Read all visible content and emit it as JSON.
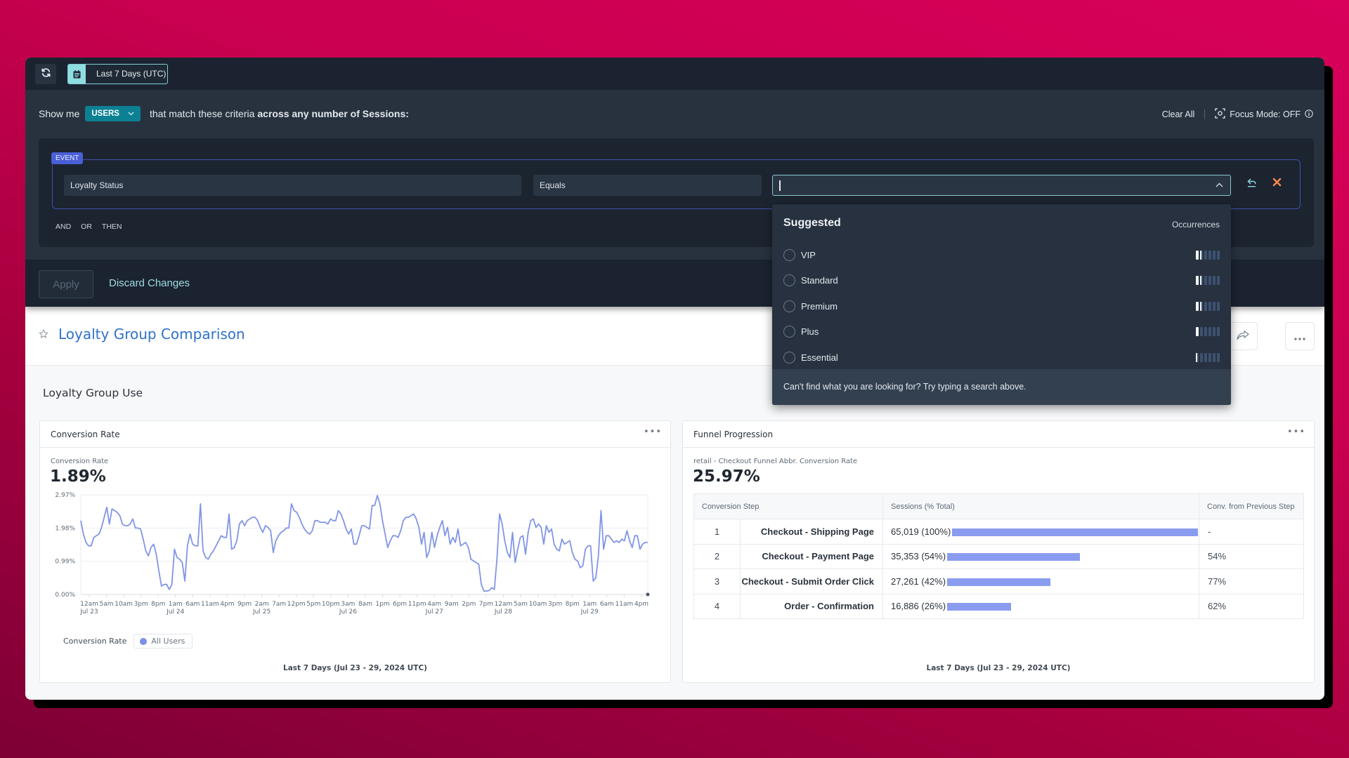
{
  "toolbar": {
    "refresh_icon": "refresh-icon",
    "date_range_icon": "calendar-icon",
    "date_range_label": "Last 7 Days (UTC)"
  },
  "query": {
    "prefix": "Show me",
    "entity": "USERS",
    "middle": "that match these criteria",
    "suffix_bold": "across any number of Sessions:",
    "clear_all": "Clear All",
    "focus_mode": "Focus Mode: OFF",
    "criteria": {
      "badge": "EVENT",
      "attribute": "Loyalty Status",
      "operator": "Equals",
      "value": "",
      "logic": [
        "AND",
        "OR",
        "THEN"
      ]
    }
  },
  "actions": {
    "apply": "Apply",
    "discard": "Discard Changes"
  },
  "dropdown": {
    "title": "Suggested",
    "occurrences_label": "Occurrences",
    "options": [
      {
        "label": "VIP",
        "occurrence_level": 1.8
      },
      {
        "label": "Standard",
        "occurrence_level": 1.8
      },
      {
        "label": "Premium",
        "occurrence_level": 1.8
      },
      {
        "label": "Plus",
        "occurrence_level": 1
      },
      {
        "label": "Essential",
        "occurrence_level": 0.5
      }
    ],
    "occurrence_scale_max": 6,
    "footer": "Can't find what you are looking for? Try typing a search above."
  },
  "page": {
    "title": "Loyalty Group Comparison",
    "section_title": "Loyalty Group Use"
  },
  "conversion_card": {
    "title": "Conversion Rate",
    "metric_label": "Conversion Rate",
    "metric_value": "1.89%",
    "legend_label": "Conversion Rate",
    "legend_series": "All Users",
    "footer": "Last 7 Days (Jul 23 - 29, 2024 UTC)"
  },
  "funnel_card": {
    "title": "Funnel Progression",
    "metric_label": "retail - Checkout Funnel Abbr. Conversion Rate",
    "metric_value": "25.97%",
    "columns": [
      "Conversion Step",
      "Sessions (% Total)",
      "Conv. from Previous Step"
    ],
    "rows": [
      {
        "num": "1",
        "step": "Checkout - Shipping Page",
        "sessions": "65,019 (100%)",
        "pct": 100,
        "conv": "-"
      },
      {
        "num": "2",
        "step": "Checkout - Payment Page",
        "sessions": "35,353 (54%)",
        "pct": 54,
        "conv": "54%"
      },
      {
        "num": "3",
        "step": "Checkout - Submit Order Click",
        "sessions": "27,261 (42%)",
        "pct": 42,
        "conv": "77%"
      },
      {
        "num": "4",
        "step": "Order - Confirmation",
        "sessions": "16,886 (26%)",
        "pct": 26,
        "conv": "62%"
      }
    ],
    "footer": "Last 7 Days (Jul 23 - 29, 2024 UTC)"
  },
  "chart_data": {
    "type": "line",
    "title": "Conversion Rate",
    "xlabel": "",
    "ylabel": "",
    "ylim": [
      0,
      2.97
    ],
    "y_ticks": [
      "0.00%",
      "0.99%",
      "1.98%",
      "2.97%"
    ],
    "y_tick_values": [
      0,
      0.99,
      1.98,
      2.97
    ],
    "x_ticks": [
      "12am",
      "5am",
      "10am",
      "3pm",
      "8pm",
      "1am",
      "6am",
      "11am",
      "4pm",
      "9pm",
      "2am",
      "7am",
      "12pm",
      "5pm",
      "10pm",
      "3am",
      "8am",
      "1pm",
      "6pm",
      "11pm",
      "4am",
      "9am",
      "2pm",
      "7pm",
      "12am",
      "5am",
      "10am",
      "3pm",
      "8pm",
      "1am",
      "6am",
      "11am",
      "4pm"
    ],
    "x_date_labels": [
      {
        "tick_index": 0,
        "label": "Jul 23"
      },
      {
        "tick_index": 5,
        "label": "Jul 24"
      },
      {
        "tick_index": 10,
        "label": "Jul 25"
      },
      {
        "tick_index": 15,
        "label": "Jul 26"
      },
      {
        "tick_index": 20,
        "label": "Jul 27"
      },
      {
        "tick_index": 24,
        "label": "Jul 28"
      },
      {
        "tick_index": 29,
        "label": "Jul 29"
      }
    ],
    "grid": true,
    "series": [
      {
        "name": "All Users",
        "color": "#8195e6",
        "values": [
          2.2,
          1.8,
          1.55,
          1.45,
          1.45,
          1.7,
          1.75,
          1.8,
          2.0,
          2.3,
          2.6,
          2.1,
          2.55,
          2.5,
          2.45,
          2.35,
          2.1,
          2.05,
          2.05,
          2.1,
          2.25,
          1.98,
          1.98,
          1.95,
          1.65,
          1.3,
          1.15,
          1.4,
          1.5,
          1.2,
          0.7,
          0.25,
          0.3,
          0.3,
          0.15,
          0.3,
          1.35,
          1.1,
          1.05,
          0.95,
          0.4,
          1.45,
          1.8,
          1.5,
          1.45,
          1.45,
          2.7,
          1.3,
          1.1,
          1.05,
          1.2,
          1.3,
          1.45,
          1.6,
          1.75,
          1.7,
          1.7,
          2.4,
          1.35,
          1.4,
          1.6,
          2.1,
          2.2,
          2.05,
          2.2,
          2.25,
          2.3,
          2.3,
          2.2,
          2.0,
          1.85,
          2.05,
          2.0,
          1.9,
          1.25,
          1.6,
          1.75,
          1.85,
          1.9,
          1.98,
          1.98,
          2.7,
          2.5,
          2.45,
          2.3,
          2.1,
          1.95,
          1.85,
          1.8,
          1.9,
          2.2,
          2.2,
          2.15,
          2.15,
          2.15,
          2.1,
          2.25,
          2.2,
          2.2,
          2.5,
          2.4,
          2.2,
          1.95,
          1.8,
          1.95,
          1.5,
          1.5,
          1.75,
          2.05,
          2.05,
          2.0,
          1.95,
          2.65,
          2.65,
          2.95,
          2.7,
          2.2,
          1.8,
          1.4,
          1.6,
          1.75,
          1.75,
          1.7,
          1.9,
          2.2,
          2.3,
          2.3,
          2.35,
          2.4,
          2.25,
          2.0,
          1.5,
          1.85,
          1.1,
          1.3,
          1.85,
          1.4,
          1.75,
          2.0,
          2.2,
          1.75,
          2.0,
          1.5,
          1.7,
          1.55,
          1.95,
          1.45,
          1.5,
          1.55,
          1.4,
          1.05,
          1.0,
          0.95,
          0.9,
          0.3,
          0.1,
          0.1,
          0.12,
          0.2,
          0.15,
          1.05,
          2.4,
          2.1,
          1.6,
          1.25,
          1.1,
          1.85,
          0.95,
          1.35,
          1.7,
          1.75,
          1.2,
          1.85,
          2.2,
          2.25,
          2.0,
          2.1,
          2.0,
          1.5,
          2.05,
          1.85,
          1.95,
          1.5,
          1.35,
          1.3,
          1.65,
          1.5,
          1.55,
          1.6,
          1.25,
          1.05,
          1.0,
          0.8,
          0.85,
          1.35,
          1.45,
          1.45,
          0.4,
          0.5,
          1.15,
          2.5,
          1.35,
          1.75,
          1.75,
          1.65,
          1.55,
          1.6,
          1.55,
          1.65,
          1.6,
          1.9,
          1.6,
          1.4,
          1.75,
          1.75,
          1.35,
          1.5,
          1.55,
          1.55
        ]
      }
    ],
    "legend": {
      "label": "Conversion Rate",
      "entries": [
        "All Users"
      ],
      "position": "bottom-left"
    }
  }
}
